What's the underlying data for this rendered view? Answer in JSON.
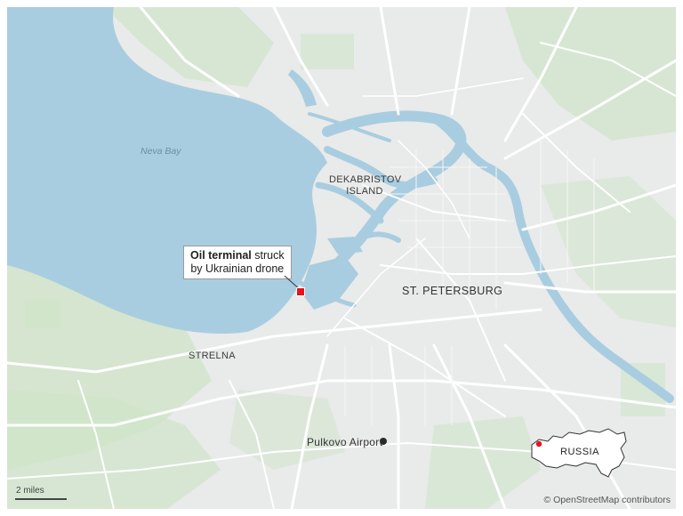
{
  "water": {
    "bay_name": "Neva Bay"
  },
  "places": {
    "island": "DEKABRISTOV ISLAND",
    "city": "ST. PETERSBURG",
    "strelna": "STRELNA",
    "airport": "Pulkovo Airport"
  },
  "callout": {
    "bold": "Oil terminal",
    "rest_line1": " struck",
    "line2": "by Ukrainian drone"
  },
  "inset": {
    "label": "RUSSIA"
  },
  "scale": {
    "label": "2 miles"
  },
  "attribution": "© OpenStreetMap contributors",
  "colors": {
    "water": "#a9cde0",
    "land": "#e9eaea",
    "parks": "#cfe4c9",
    "roads": "#ffffff",
    "marker": "#e8141c",
    "river": "#a9cde0"
  }
}
